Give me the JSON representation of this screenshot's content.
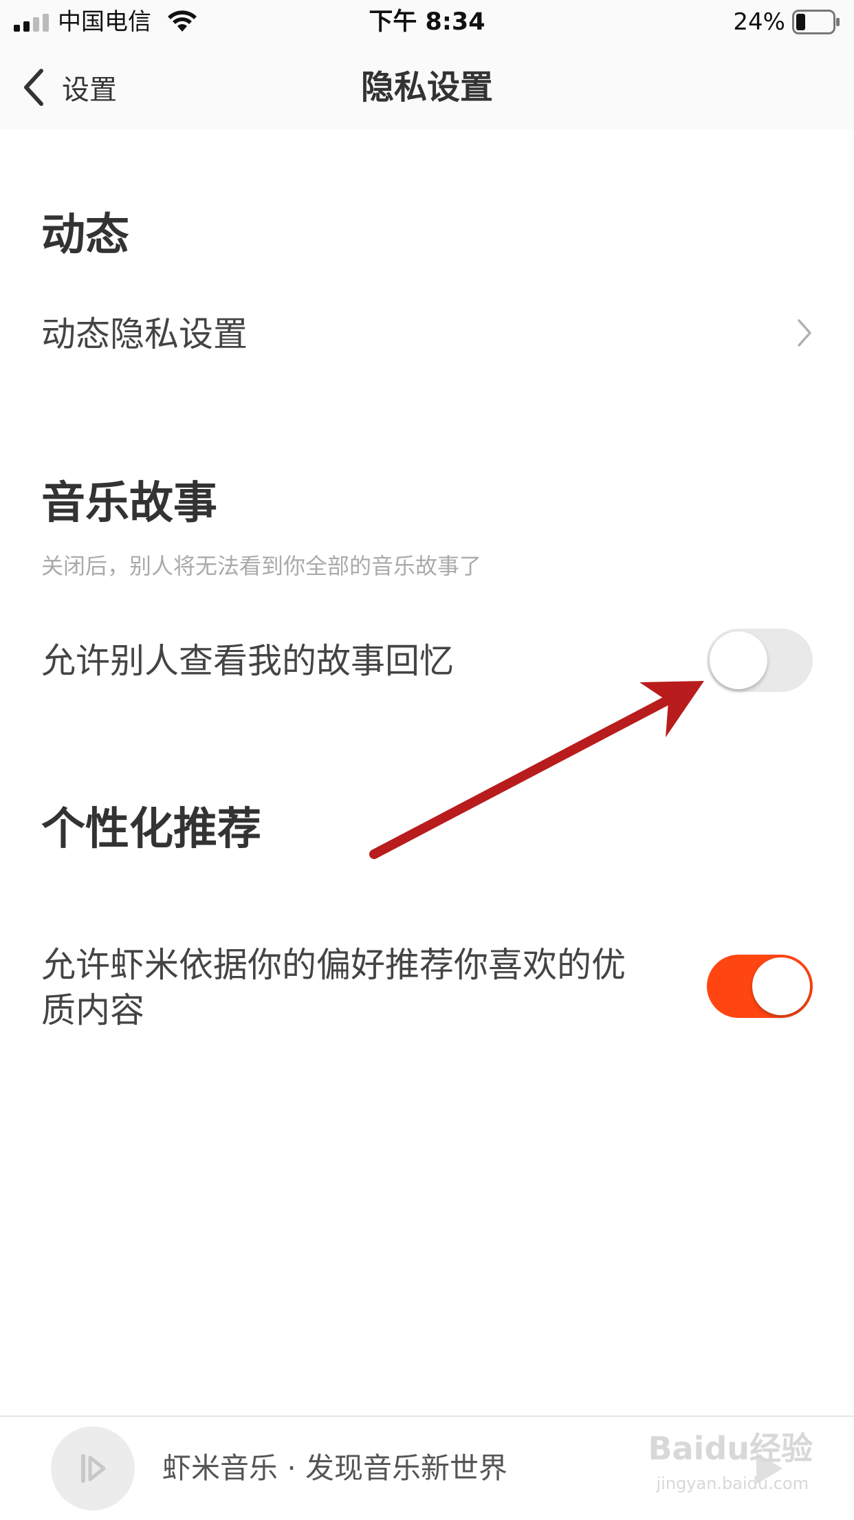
{
  "status_bar": {
    "carrier": "中国电信",
    "time": "下午 8:34",
    "battery": "24%"
  },
  "nav": {
    "back_label": "设置",
    "title": "隐私设置"
  },
  "sections": {
    "feed": {
      "heading": "动态",
      "row_label": "动态隐私设置"
    },
    "music_story": {
      "heading": "音乐故事",
      "hint": "关闭后，别人将无法看到你全部的音乐故事了",
      "toggle_label": "允许别人查看我的故事回忆",
      "toggle_on": false
    },
    "recommend": {
      "heading": "个性化推荐",
      "toggle_label_line1": "允许虾米依据你的偏好推荐你喜欢的优",
      "toggle_label_line2": "质内容",
      "toggle_on": true
    }
  },
  "player": {
    "text": "虾米音乐 · 发现音乐新世界"
  },
  "watermark": {
    "main": "Baidu经验",
    "sub": "jingyan.baidu.com"
  },
  "colors": {
    "accent": "#ff4612",
    "toggle_off": "#e9e9ea",
    "annotation_arrow": "#b81c1c"
  }
}
